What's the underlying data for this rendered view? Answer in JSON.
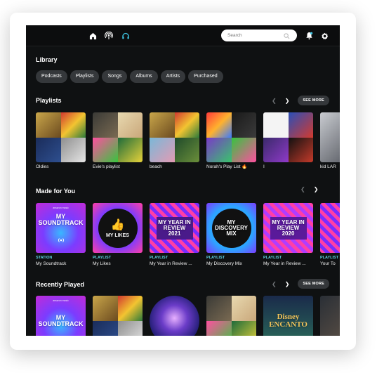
{
  "app": {
    "name": "Amazon Music"
  },
  "topbar": {
    "nav": [
      {
        "name": "home-icon",
        "active": false
      },
      {
        "name": "podcast-icon",
        "active": false
      },
      {
        "name": "headphones-icon",
        "active": true
      }
    ],
    "search_placeholder": "Search",
    "accent_color": "#3ec8e6"
  },
  "library": {
    "title": "Library",
    "filters": [
      "Podcasts",
      "Playlists",
      "Songs",
      "Albums",
      "Artists",
      "Purchased"
    ]
  },
  "playlists": {
    "title": "Playlists",
    "see_more": "SEE MORE",
    "items": [
      {
        "name": "Oldies"
      },
      {
        "name": "Evie's playlist"
      },
      {
        "name": "beach"
      },
      {
        "name": "Norah's Play List 🔥"
      },
      {
        "name": "I"
      },
      {
        "name": "kid LAR"
      }
    ]
  },
  "made_for_you": {
    "title": "Made for You",
    "items": [
      {
        "kind": "STATION",
        "name": "My Soundtrack",
        "art_text": "MY SOUNDTRACK"
      },
      {
        "kind": "PLAYLIST",
        "name": "My Likes",
        "art_text": "MY LIKES"
      },
      {
        "kind": "PLAYLIST",
        "name": "My Year in Review ...",
        "art_text": "MY YEAR IN REVIEW 2021"
      },
      {
        "kind": "PLAYLIST",
        "name": "My Discovery Mix",
        "art_text": "MY DISCOVERY MIX"
      },
      {
        "kind": "PLAYLIST",
        "name": "My Year in Review ...",
        "art_text": "MY YEAR IN REVIEW 2020"
      },
      {
        "kind": "PLAYLIST",
        "name": "Your To"
      }
    ]
  },
  "recently_played": {
    "title": "Recently Played",
    "see_more": "SEE MORE",
    "items": [
      {
        "art_text": "MY SOUNDTRACK"
      },
      {
        "art_text": ""
      },
      {
        "art_text": ""
      },
      {
        "art_text": ""
      },
      {
        "art_text": "Disney ENCANTO"
      },
      {
        "art_text": ""
      }
    ]
  }
}
